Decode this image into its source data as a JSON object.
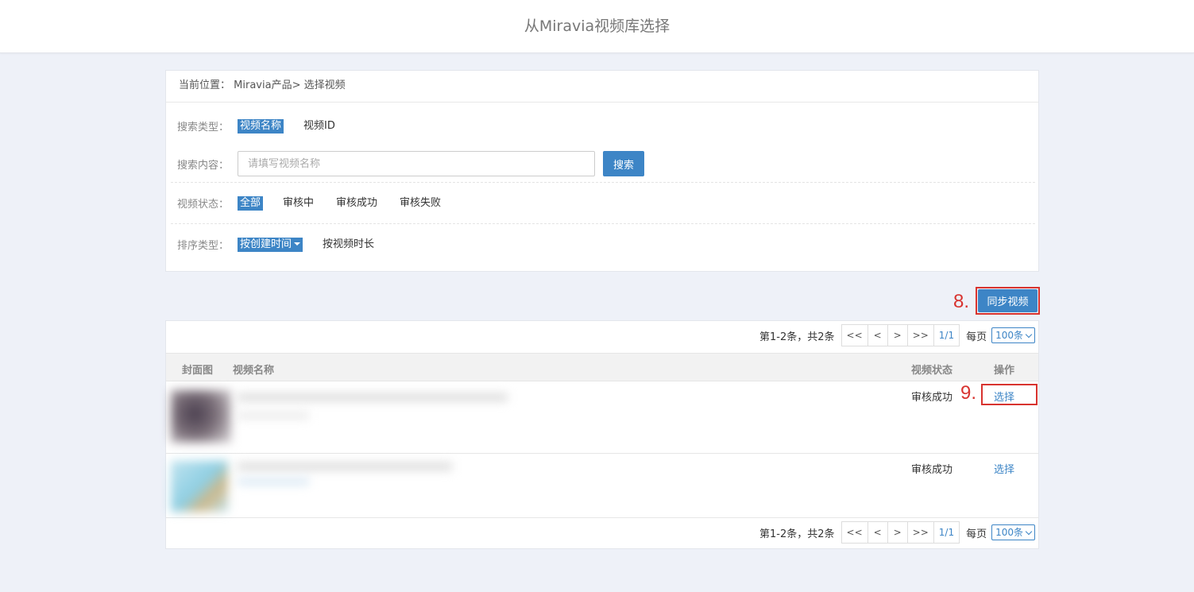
{
  "header": {
    "title": "从Miravia视频库选择"
  },
  "breadcrumb": {
    "label": "当前位置：",
    "path": "Miravia产品> 选择视频"
  },
  "filters": {
    "search_type": {
      "label": "搜索类型：",
      "options": [
        "视频名称",
        "视频ID"
      ],
      "selected": "视频名称"
    },
    "search_content": {
      "label": "搜索内容：",
      "placeholder": "请填写视频名称",
      "value": "",
      "button": "搜索"
    },
    "status": {
      "label": "视频状态：",
      "options": [
        "全部",
        "审核中",
        "审核成功",
        "审核失败"
      ],
      "selected": "全部"
    },
    "sort": {
      "label": "排序类型：",
      "options": [
        "按创建时间",
        "按视频时长"
      ],
      "selected": "按创建时间"
    }
  },
  "sync_button": {
    "label": "同步视频"
  },
  "annotations": {
    "step8": "8.",
    "step9": "9."
  },
  "pager": {
    "info": "第1-2条，共2条",
    "buttons": [
      "<<",
      "<",
      ">",
      ">>"
    ],
    "current": "1/1",
    "per_page_label": "每页",
    "per_page_value": "100条"
  },
  "table": {
    "columns": {
      "cover": "封面图",
      "name": "视频名称",
      "status": "视频状态",
      "action": "操作"
    },
    "rows": [
      {
        "status": "审核成功",
        "action": "选择"
      },
      {
        "status": "审核成功",
        "action": "选择"
      }
    ]
  },
  "colors": {
    "accent": "#3d85c6",
    "annotation": "#d8332f",
    "background": "#eef1f8"
  }
}
